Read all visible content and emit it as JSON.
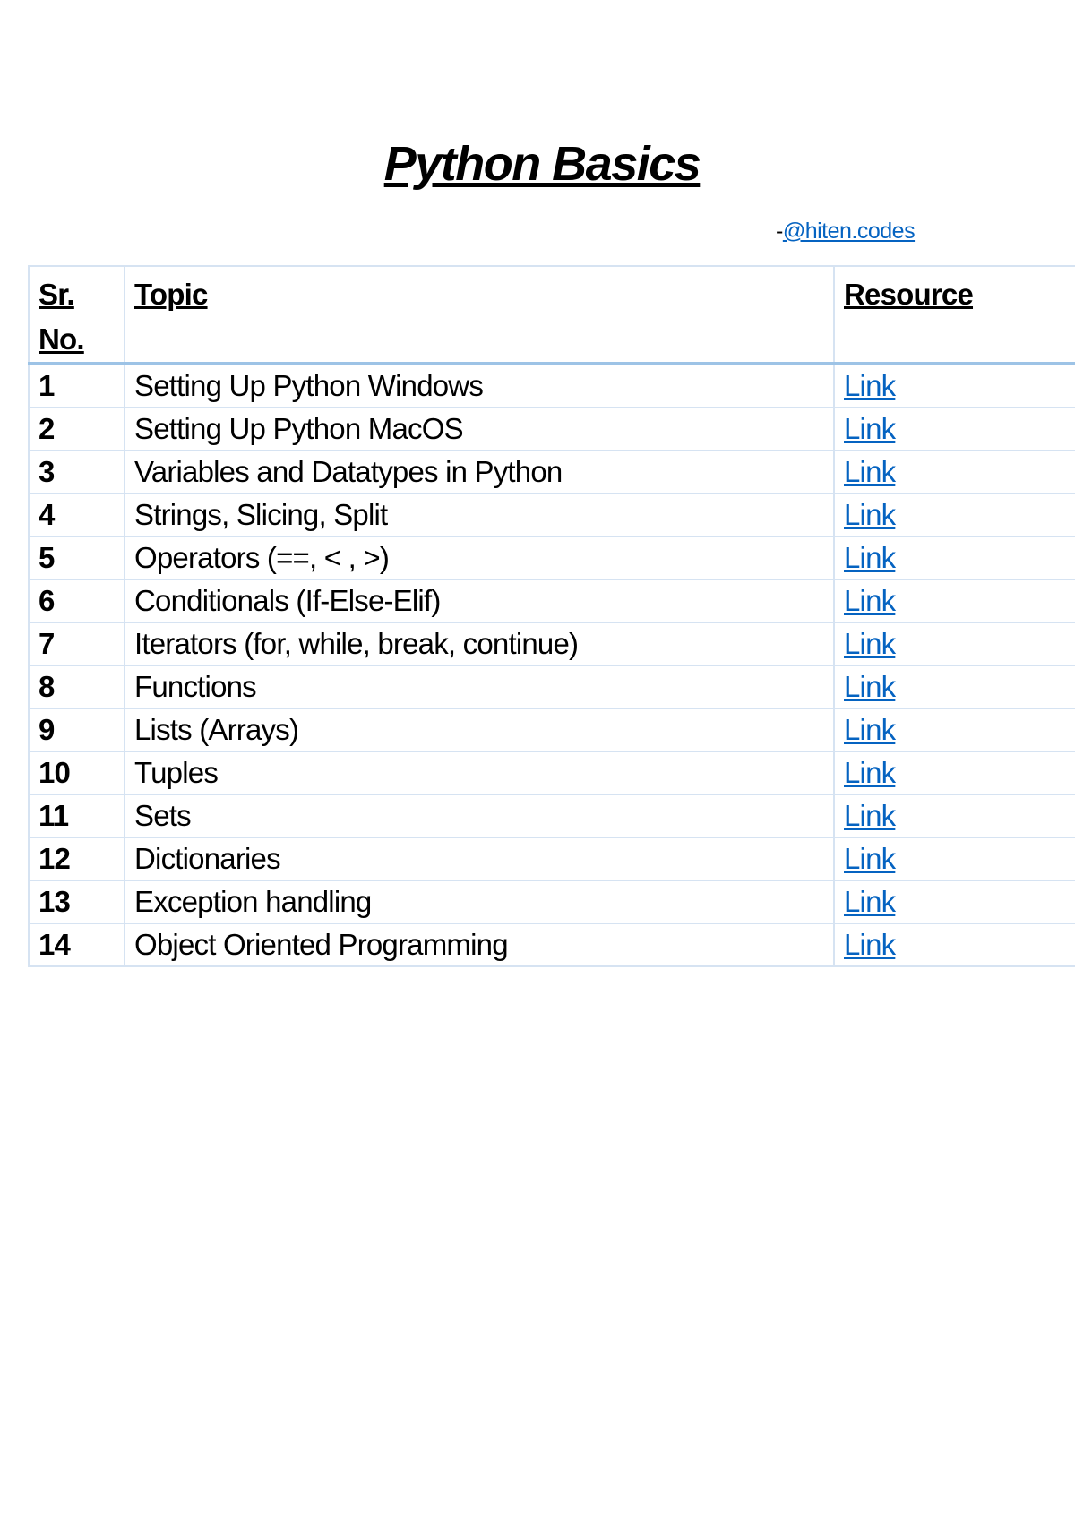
{
  "title": "Python Basics",
  "author": {
    "prefix": "-",
    "handle": "@hiten.codes"
  },
  "table": {
    "headers": {
      "sr": "Sr. No.",
      "topic": "Topic",
      "resource": "Resource"
    },
    "rows": [
      {
        "no": "1",
        "topic": "Setting Up Python Windows",
        "link": "Link"
      },
      {
        "no": "2",
        "topic": "Setting Up Python MacOS",
        "link": "Link"
      },
      {
        "no": "3",
        "topic": "Variables and Datatypes in Python",
        "link": "Link"
      },
      {
        "no": "4",
        "topic": "Strings, Slicing, Split",
        "link": "Link"
      },
      {
        "no": "5",
        "topic": "Operators (==, < , >)",
        "link": "Link"
      },
      {
        "no": "6",
        "topic": "Conditionals (If-Else-Elif)",
        "link": "Link"
      },
      {
        "no": "7",
        "topic": "Iterators (for, while, break, continue)",
        "link": "Link"
      },
      {
        "no": "8",
        "topic": "Functions",
        "link": "Link"
      },
      {
        "no": "9",
        "topic": "Lists (Arrays)",
        "link": "Link"
      },
      {
        "no": "10",
        "topic": "Tuples",
        "link": "Link"
      },
      {
        "no": "11",
        "topic": "Sets",
        "link": "Link"
      },
      {
        "no": "12",
        "topic": "Dictionaries",
        "link": "Link"
      },
      {
        "no": "13",
        "topic": "Exception handling",
        "link": "Link"
      },
      {
        "no": "14",
        "topic": "Object Oriented Programming",
        "link": "Link"
      }
    ]
  },
  "colors": {
    "link": "#0563c1",
    "border": "#d6e3f2",
    "header_border": "#9dc3e6"
  }
}
